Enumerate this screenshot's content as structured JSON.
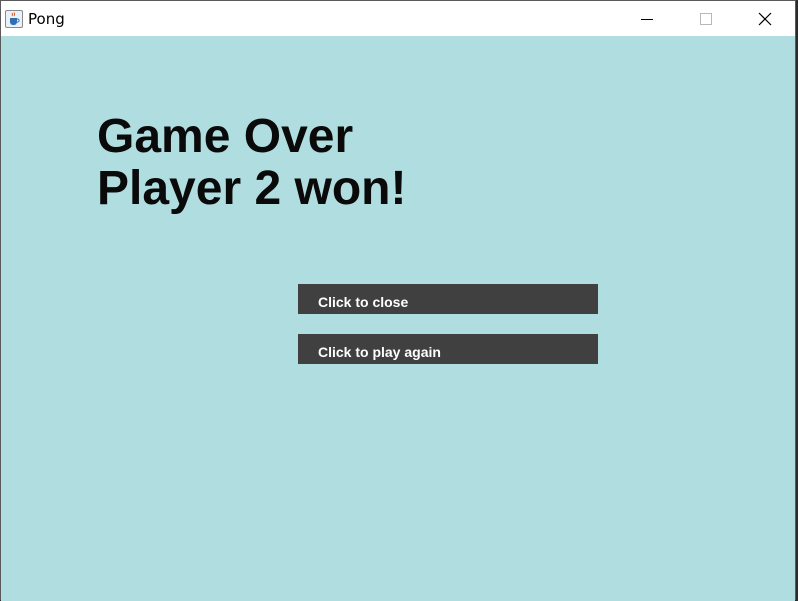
{
  "window": {
    "title": "Pong",
    "app_icon": "java-cup-icon",
    "background_color": "#b0dde0"
  },
  "controls": {
    "minimize_icon": "minimize-icon",
    "maximize_icon": "maximize-icon",
    "close_icon": "close-icon"
  },
  "game": {
    "headline_line1": "Game Over",
    "headline_line2": "Player 2 won!",
    "close_button_label": "Click to close",
    "play_again_button_label": "Click to play again",
    "button_color": "#404040"
  }
}
